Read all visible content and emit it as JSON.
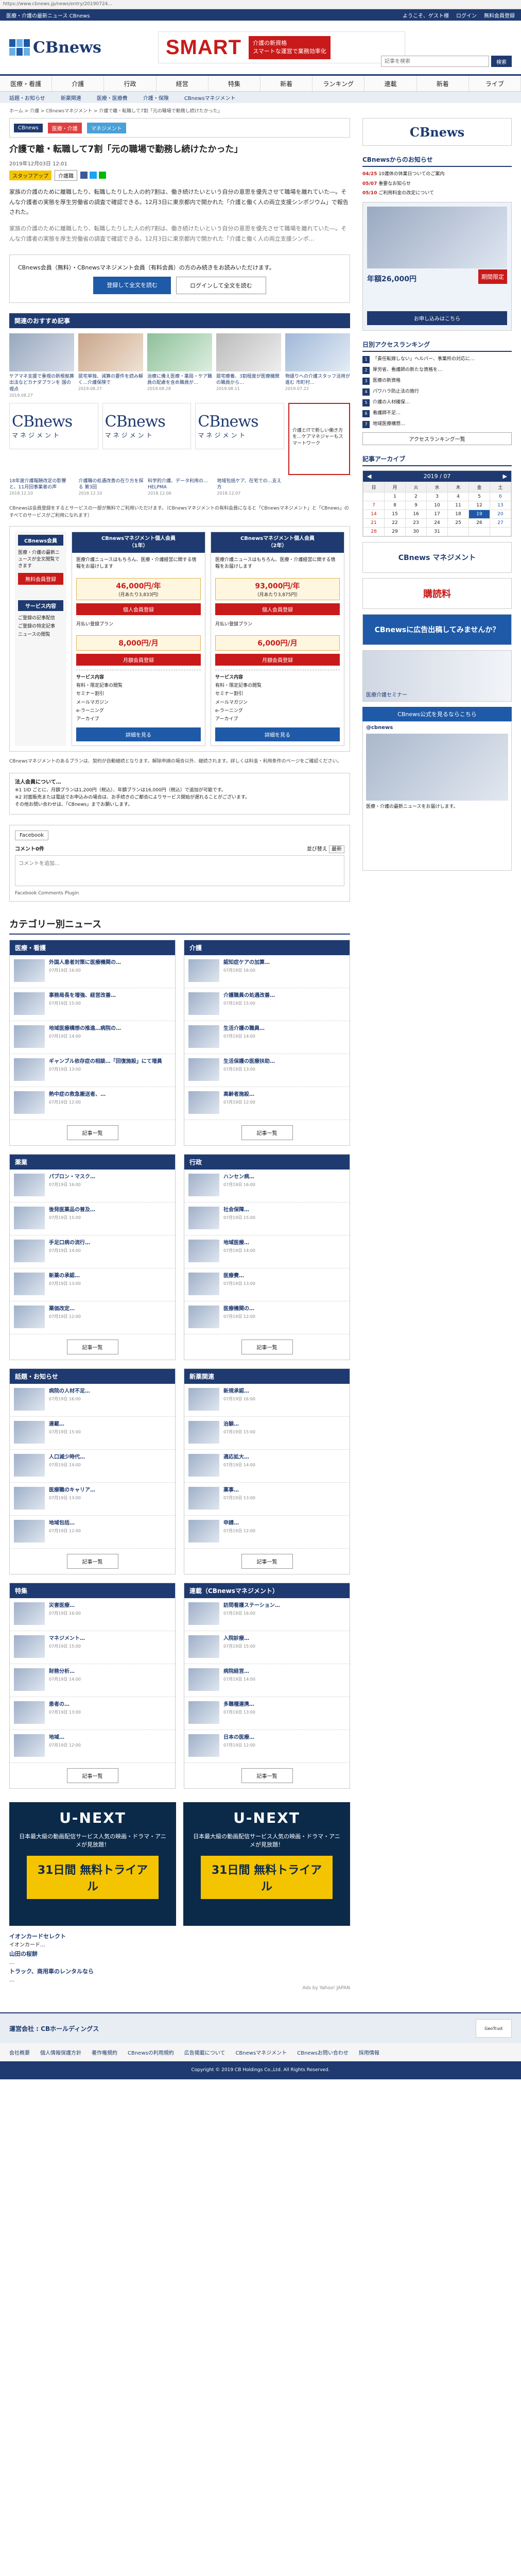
{
  "browser": {
    "url": "https://www.cbnews.jp/news/entry/20190724..."
  },
  "topbar": {
    "left": "医療・介護の最新ニュース CBnews",
    "links": [
      "ようこそ、ゲスト様",
      "ログイン",
      "無料会員登録"
    ]
  },
  "header": {
    "logo": "CBnews",
    "banner_word": "SMART",
    "banner_text": "介護の新資格\nスマートな運営で業務効率化"
  },
  "search": {
    "placeholder": "記事を検索",
    "button": "検索"
  },
  "nav": [
    "医療・看護",
    "介護",
    "行政",
    "経営",
    "特集",
    "新着",
    "ランキング",
    "連載",
    "新着",
    "ライブ"
  ],
  "subnav": [
    "話題・お知らせ",
    "新薬関連",
    "医療・医療費",
    "介護・保険",
    "CBnewsマネジメント"
  ],
  "breadcrumb": "ホーム > 介護 > CBnewsマネジメント > 介護で離・転職して7割「元の職場で勤務し続けたかった」",
  "article": {
    "strip": [
      "CBnews",
      "医療・介護",
      "マネジメント"
    ],
    "title": "介護で離・転職して7割「元の職場で勤務し続けたかった」",
    "date": "2019年12月03日 12:01",
    "badge": "スタッフアップ",
    "badge_kw": "介護職",
    "lead1": "家族の介護のために離職したり、転職したりした人の約7割は、働き続けたいという自分の意思を優先させて職場を離れていた―。そんな介護者の実態を厚生労働省の調査で確認できる。12月3日に東京都内で開かれた「介護と働く人の両立支援シンポジウム」で報告された。",
    "lead2": "家族の介護のために離職したり、転職したりした人の約7割は、働き続けたいという自分の意思を優先させて職場を離れていた―。そんな介護者の実態を厚生労働省の調査で確認できる。12月3日に東京都内で開かれた「介護と働く人の両立支援シンポ…",
    "member_text": "CBnews会員（無料）・CBnewsマネジメント会員（有料会員）の方のみ続きをお読みいただけます。",
    "btn_register": "登録して全文を読む",
    "btn_login": "ログインして全文を読む"
  },
  "recommend": {
    "heading": "関連のおすすめ記事",
    "items": [
      {
        "title": "ケアマネ支援で重視の新根拠算出法などカナダプランを 国の視点",
        "date": "2019.08.27"
      },
      {
        "title": "居宅単独、減算の要件を読み解く…介護保険で",
        "date": "2019.08.27"
      },
      {
        "title": "治療に備え医療・薬局・ケア職員の配慮を含め職員が…",
        "date": "2019.08.28"
      },
      {
        "title": "居宅療養、3割程度が医療機関の職員から…",
        "date": "2019.08.11"
      },
      {
        "title": "物語りへの介護スタッフ活用が進む 市町村…",
        "date": "2019.07.22"
      }
    ],
    "logo_big": "CBnews",
    "logo_sub": "マネジメント",
    "ad_text": "介護とITで新しい働き方を…ケアマネジャーもスマートワーク",
    "items2": [
      {
        "title": "18年度介護報酬改定の影響と、11月回事業者の声",
        "date": "2018.12.10"
      },
      {
        "title": "介護職の処遇改善の在り方を探る 第3回",
        "date": "2018.12.10"
      },
      {
        "title": "科学的介護、データ利用の…HELPMA",
        "date": "2018.12.06"
      },
      {
        "title": "地域包括ケア、在宅での…支え方",
        "date": "2018.12.07"
      }
    ]
  },
  "plans": {
    "note": "CBnewsは会員登録をするとサービスの一部が無料でご利用いただけます。（CBnewsマネジメントの有料会員になると「CBnewsマネジメント」と「CBnews」のすべてのサービスがご利用になれます）",
    "left_title": "CBnews会員",
    "left_text": "医療・介護の最新ニュースが全文閲覧できます",
    "left_btn": "無料会員登録",
    "service_head": "サービス内容",
    "left_services": "ご登録の記事配信\nご登録の特定記事\nニュースの閲覧",
    "cols": [
      {
        "name": "CBnewsマネジメント個人会員\n（1年）",
        "desc": "医療介護ニュースはもちろん、医療・介護経営に関する情報をお届けします",
        "price": "46,000円/年",
        "price_sub": "（月あたり3,833円）",
        "btn": "個人会員登録",
        "services": "有料・限定記事の閲覧\nセミナー割引\nメールマガジン\ne-ラーニング\nアーカイブ",
        "detail": "詳細を見る"
      },
      {
        "name": "CBnewsマネジメント個人会員\n（2年）",
        "desc": "医療介護ニュースはもちろん、医療・介護経営に関する情報をお届けします",
        "price": "93,000円/年",
        "price_sub": "（月あたり3,875円）",
        "btn": "個人会員登録",
        "services": "有料・限定記事の閲覧\nセミナー割引\nメールマガジン\ne-ラーニング\nアーカイブ",
        "detail": "詳細を見る"
      }
    ],
    "month_cols": [
      {
        "label": "月払い登録プラン",
        "price": "8,000円/月",
        "btn": "月額会員登録"
      },
      {
        "label": "月払い登録プラン",
        "price": "6,000円/月",
        "btn": "月額会員登録"
      }
    ],
    "bottom_note": "CBnewsマネジメントのあるプランは、契約が自動継続となります。解除申請の場合以外、継続されます。詳しくは料金・利用条件のページをご確認ください。"
  },
  "corp": {
    "title": "法人会員について…",
    "lines": [
      "※1 1ID ごとに、月額プランは1,200円（税込）、年額プランは16,000円（税込）で追加が可能です。",
      "※2 対面販売または電話でお申込みの場合は、お手続きのご都合によりサービス開始が遅れることがございます。",
      "その他お問い合わせは、「CBnews」までお願いします。"
    ]
  },
  "facebook": {
    "tab": "Facebook",
    "count": "コメント0件",
    "sort_label": "並び替え",
    "sort_value": "最新",
    "placeholder": "コメントを追加...",
    "plugin": "Facebook Comments Plugin"
  },
  "categories": {
    "heading": "カテゴリー別ニュース",
    "more": "記事一覧",
    "blocks": [
      {
        "name": "医療・看護",
        "items": [
          {
            "title": "外国人患者対策に医療機関の…",
            "date": "07月19日 16:00"
          },
          {
            "title": "事務局長を増強、経営改善…",
            "date": "07月19日 15:00"
          },
          {
            "title": "地域医療構想の推進…病院の…",
            "date": "07月19日 14:00"
          },
          {
            "title": "ギャンブル依存症の相談…「回復施設」にて増員",
            "date": "07月19日 13:00"
          },
          {
            "title": "熱中症の救急搬送者、…",
            "date": "07月19日 12:00"
          }
        ]
      },
      {
        "name": "介護",
        "items": [
          {
            "title": "認知症ケアの加算…",
            "date": "07月19日 16:00"
          },
          {
            "title": "介護職員の処遇改善…",
            "date": "07月19日 15:00"
          },
          {
            "title": "生活介護の職員…",
            "date": "07月19日 14:00"
          },
          {
            "title": "生活保護の医療扶助…",
            "date": "07月19日 13:00"
          },
          {
            "title": "高齢者施設…",
            "date": "07月19日 12:00"
          }
        ]
      },
      {
        "name": "薬業",
        "items": [
          {
            "title": "パブロン・マスク…",
            "date": "07月19日 16:00"
          },
          {
            "title": "後発医薬品の普及…",
            "date": "07月19日 15:00"
          },
          {
            "title": "手足口病の流行…",
            "date": "07月19日 14:00"
          },
          {
            "title": "新薬の承認…",
            "date": "07月19日 13:00"
          },
          {
            "title": "薬価改定…",
            "date": "07月19日 12:00"
          }
        ]
      },
      {
        "name": "行政",
        "items": [
          {
            "title": "ハンセン病…",
            "date": "07月19日 16:00"
          },
          {
            "title": "社会保障…",
            "date": "07月19日 15:00"
          },
          {
            "title": "地域医療…",
            "date": "07月19日 14:00"
          },
          {
            "title": "医療費…",
            "date": "07月19日 13:00"
          },
          {
            "title": "医療機関の…",
            "date": "07月19日 12:00"
          }
        ]
      },
      {
        "name": "話題・お知らせ",
        "items": [
          {
            "title": "病院の人材不足…",
            "date": "07月19日 16:00"
          },
          {
            "title": "連載…",
            "date": "07月19日 15:00"
          },
          {
            "title": "人口減少時代…",
            "date": "07月19日 14:00"
          },
          {
            "title": "医療職のキャリア…",
            "date": "07月19日 13:00"
          },
          {
            "title": "地域包括…",
            "date": "07月19日 12:00"
          }
        ]
      },
      {
        "name": "新薬関連",
        "items": [
          {
            "title": "新規承認…",
            "date": "07月19日 16:00"
          },
          {
            "title": "治験…",
            "date": "07月19日 15:00"
          },
          {
            "title": "適応拡大…",
            "date": "07月19日 14:00"
          },
          {
            "title": "薬事…",
            "date": "07月19日 13:00"
          },
          {
            "title": "申請…",
            "date": "07月19日 12:00"
          }
        ]
      },
      {
        "name": "特集",
        "items": [
          {
            "title": "災害医療…",
            "date": "07月19日 16:00"
          },
          {
            "title": "マネジメント…",
            "date": "07月19日 15:00"
          },
          {
            "title": "財務分析…",
            "date": "07月19日 14:00"
          },
          {
            "title": "患者の…",
            "date": "07月19日 13:00"
          },
          {
            "title": "地域…",
            "date": "07月19日 12:00"
          }
        ]
      },
      {
        "name": "連載（CBnewsマネジメント）",
        "items": [
          {
            "title": "訪問看護ステーション…",
            "date": "07月19日 16:00"
          },
          {
            "title": "入院診療…",
            "date": "07月19日 15:00"
          },
          {
            "title": "病院経営…",
            "date": "07月19日 14:00"
          },
          {
            "title": "多職種連携…",
            "date": "07月19日 13:00"
          },
          {
            "title": "日本の医療…",
            "date": "07月19日 12:00"
          }
        ]
      }
    ]
  },
  "ads": {
    "unext_logo": "U-NEXT",
    "unext_msg": "日本最大級の動画配信サービス人気の映画・ドラマ・アニメが見放題！",
    "unext_free": "31日間 無料トライアル",
    "text_ads": [
      {
        "title": "イオンカードセレクト",
        "body": "イオンカード…"
      },
      {
        "title": "山田の桜餅",
        "body": "…"
      },
      {
        "title": "トラック、商用車のレンタルなら",
        "body": "…"
      }
    ],
    "by": "Ads by Yahoo! JAPAN"
  },
  "side": {
    "banner": "CBnews",
    "notice_heading": "CBnewsからのお知らせ",
    "notices": [
      {
        "date": "04/25",
        "text": "10連休の休業日ついてのご案内"
      },
      {
        "date": "05/07",
        "text": "重要なお知らせ"
      },
      {
        "date": "05/10",
        "text": "ご利用料金の改定について"
      }
    ],
    "ad_price": "年額26,000円",
    "ad_tag": "期間限定",
    "ad_cta": "お申し込みはこちら",
    "rank_heading": "日別アクセスランキング",
    "rank": [
      "「責任転嫁しない」ヘルパー、事業所の対応に…",
      "厚労省、看護師の新たな資格を…",
      "医療の新資格",
      "パワハラ防止法の施行",
      "介護の人材確保…",
      "看護師不足…",
      "地域医療構想…"
    ],
    "rank_select": "アクセスランキング一覧",
    "archive_heading": "記事アーカイブ",
    "cal_month": "2019 / 07",
    "cal_days": [
      "日",
      "月",
      "火",
      "水",
      "木",
      "金",
      "土"
    ],
    "cal_rows": [
      [
        "",
        "1",
        "2",
        "3",
        "4",
        "5",
        "6"
      ],
      [
        "7",
        "8",
        "9",
        "10",
        "11",
        "12",
        "13"
      ],
      [
        "14",
        "15",
        "16",
        "17",
        "18",
        "19",
        "20"
      ],
      [
        "21",
        "22",
        "23",
        "24",
        "25",
        "26",
        "27"
      ],
      [
        "28",
        "29",
        "30",
        "31",
        "",
        "",
        ""
      ]
    ],
    "cal_today": "19",
    "boxes": [
      "CBnews マネジメント",
      "購読料",
      "CBnewsに広告出稿してみませんか？"
    ],
    "seminar": "医療介護セミナー",
    "follow": "CBnews公式を見るならこちら",
    "twitter_title": "@cbnews",
    "twitter_text": "医療・介護の最新ニュースをお届けします。"
  },
  "footer": {
    "company": "運営会社 : CBホールディングス",
    "secure": "GeoTrust",
    "links": [
      "会社概要",
      "個人情報保護方針",
      "著作権規約",
      "CBnewsの利用規約",
      "広告掲載について",
      "CBnewsマネジメント",
      "CBnewsお問い合わせ",
      "採用情報"
    ],
    "copy": "Copyright © 2019 CB Holdings Co.,Ltd. All Rights Reserved."
  }
}
